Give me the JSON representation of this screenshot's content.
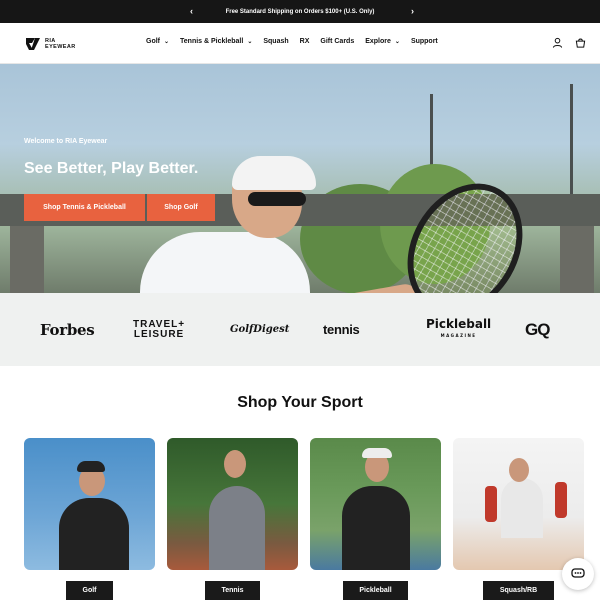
{
  "announcement": {
    "text": "Free Standard Shipping on Orders $100+ (U.S. Only)",
    "prev_icon": "chevron-left-icon",
    "next_icon": "chevron-right-icon"
  },
  "header": {
    "logo_text_1": "RIA",
    "logo_text_2": "EYEWEAR",
    "nav": [
      {
        "label": "Golf",
        "has_dropdown": true
      },
      {
        "label": "Tennis & Pickleball",
        "has_dropdown": true
      },
      {
        "label": "Squash",
        "has_dropdown": false
      },
      {
        "label": "RX",
        "has_dropdown": false
      },
      {
        "label": "Gift Cards",
        "has_dropdown": false
      },
      {
        "label": "Explore",
        "has_dropdown": true
      },
      {
        "label": "Support",
        "has_dropdown": false
      }
    ],
    "icons": [
      "account-icon",
      "cart-icon"
    ]
  },
  "hero": {
    "eyebrow": "Welcome to RIA Eyewear",
    "title": "See Better, Play Better.",
    "button_1": "Shop Tennis & Pickleball",
    "button_2": "Shop Golf",
    "accent_color": "#e8623f"
  },
  "press": {
    "logos": [
      "Forbes",
      "TRAVEL+",
      "LEISURE",
      "GolfDigest",
      "tennis",
      "Pickleball",
      "MAGAZINE",
      "GQ"
    ]
  },
  "shop": {
    "title": "Shop Your Sport",
    "cards": [
      {
        "label": "Golf"
      },
      {
        "label": "Tennis"
      },
      {
        "label": "Pickleball"
      },
      {
        "label": "Squash/RB"
      }
    ]
  },
  "chat": {
    "icon": "chat-icon"
  }
}
